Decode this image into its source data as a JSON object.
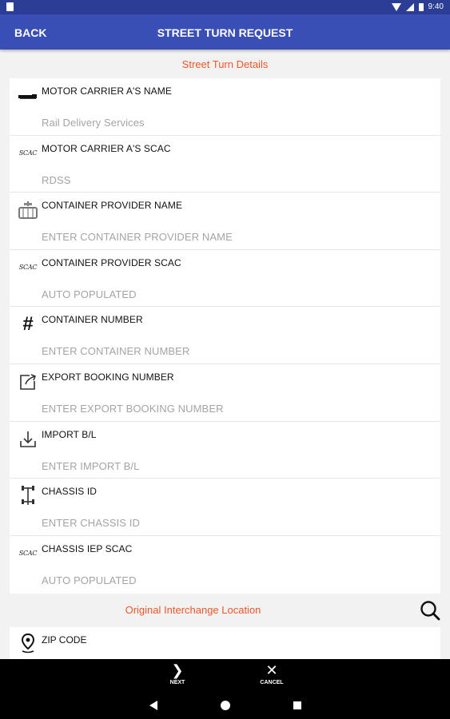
{
  "status_bar": {
    "time": "9:40"
  },
  "app_bar": {
    "back_label": "BACK",
    "title": "STREET TURN REQUEST"
  },
  "section_details": {
    "title": "Street Turn Details"
  },
  "fields": [
    {
      "icon": "truck-icon",
      "label": "MOTOR CARRIER A'S NAME",
      "value": "Rail Delivery Services"
    },
    {
      "icon": "scac-icon",
      "icon_text": "SCAC",
      "label": "MOTOR CARRIER A'S SCAC",
      "value": "RDSS"
    },
    {
      "icon": "container-icon",
      "label": "CONTAINER PROVIDER NAME",
      "value": "ENTER CONTAINER PROVIDER NAME"
    },
    {
      "icon": "scac-icon",
      "icon_text": "SCAC",
      "label": "CONTAINER PROVIDER SCAC",
      "value": "AUTO POPULATED"
    },
    {
      "icon": "hash-icon",
      "icon_text": "#",
      "label": "CONTAINER NUMBER",
      "value": "ENTER CONTAINER NUMBER"
    },
    {
      "icon": "export-icon",
      "label": "EXPORT BOOKING NUMBER",
      "value": "ENTER EXPORT BOOKING NUMBER"
    },
    {
      "icon": "import-icon",
      "label": "IMPORT B/L",
      "value": "ENTER IMPORT B/L"
    },
    {
      "icon": "chassis-icon",
      "label": "CHASSIS ID",
      "value": "ENTER CHASSIS ID"
    },
    {
      "icon": "scac-icon",
      "icon_text": "SCAC",
      "label": "CHASSIS IEP SCAC",
      "value": "AUTO POPULATED"
    }
  ],
  "section_interchange": {
    "title": "Original Interchange Location"
  },
  "zip_field": {
    "icon": "location-pin-icon",
    "label": "ZIP CODE"
  },
  "bottom_bar": {
    "next_label": "NEXT",
    "cancel_label": "CANCEL"
  },
  "colors": {
    "app_bar": "#3a4fb5",
    "status_bar": "#2c3d96",
    "section_header": "#f0562a",
    "placeholder": "#a4a4a4"
  }
}
